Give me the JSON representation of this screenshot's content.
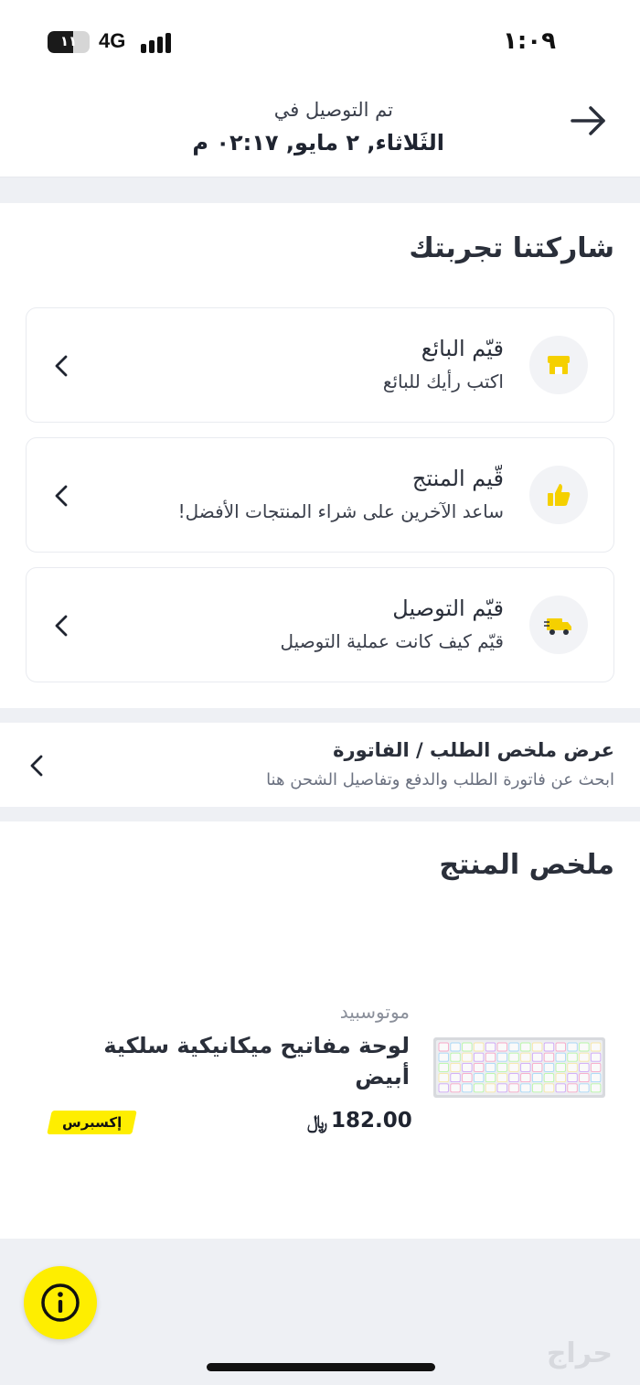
{
  "status_bar": {
    "battery_percent": "١١",
    "network": "4G",
    "time": "١:٠٩"
  },
  "header": {
    "delivered_label": "تم التوصيل في",
    "delivered_date": "الثَلاثاء, ٢ مايو, ٠٢:١٧ م"
  },
  "share_experience": {
    "title": "شاركتنا تجربتك",
    "items": [
      {
        "title": "قيّم البائع",
        "subtitle": "اكتب رأيك للبائع",
        "icon": "store-icon"
      },
      {
        "title": "قّيم المنتج",
        "subtitle": "ساعد الآخرين على شراء المنتجات الأفضل!",
        "icon": "thumbs-up-icon"
      },
      {
        "title": "قيّم التوصيل",
        "subtitle": "قيّم كيف كانت عملية التوصيل",
        "icon": "delivery-truck-icon"
      }
    ]
  },
  "invoice": {
    "title": "عرض ملخص الطلب / الفاتورة",
    "subtitle": "ابحث عن فاتورة الطلب والدفع وتفاصيل الشحن هنا"
  },
  "product_summary": {
    "title": "ملخص المنتج",
    "brand": "موتوسبيد",
    "name": "لوحة مفاتيح ميكانيكية سلكية أبيض",
    "price": "182.00",
    "currency_symbol": "﷼",
    "badge": "إكسبرس"
  },
  "watermark": "حراج",
  "colors": {
    "accent_yellow": "#feee00",
    "text_dark": "#2a2f3a",
    "background": "#eef0f4"
  }
}
